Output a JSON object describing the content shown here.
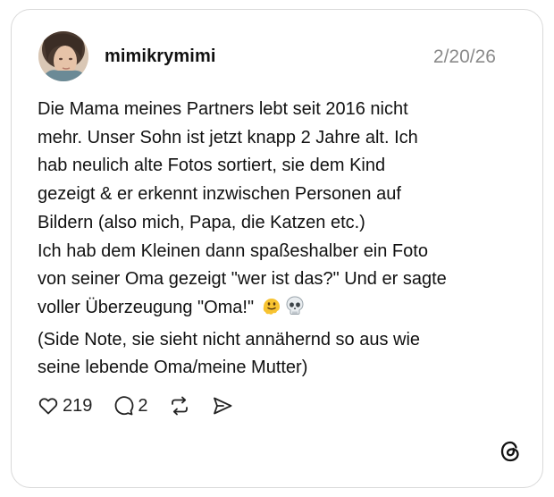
{
  "post": {
    "username": "mimikrymimi",
    "date": "2/20/26",
    "text_lines": [
      "Die Mama meines Partners lebt seit 2016 nicht",
      "mehr. Unser Sohn ist jetzt knapp 2 Jahre alt. Ich",
      "hab neulich alte Fotos sortiert, sie dem Kind",
      "gezeigt & er erkennt inzwischen Personen auf",
      "Bildern (also mich, Papa, die Katzen etc.)",
      "Ich hab dem Kleinen dann spaßeshalber ein Foto",
      "von seiner Oma gezeigt \"wer ist das?\" Und er sagte",
      "voller Überzeugung \"Oma!\"",
      "(Side Note, sie sieht nicht annähernd so aus wie",
      "seine lebende Oma/meine Mutter)"
    ],
    "emojis": [
      "melting-face-icon",
      "skull-icon"
    ]
  },
  "actions": {
    "like_count": "219",
    "reply_count": "2",
    "icons": [
      "heart-icon",
      "comment-icon",
      "repost-icon",
      "share-icon"
    ]
  },
  "branding": {
    "logo": "threads-logo-icon"
  },
  "colors": {
    "text": "#111111",
    "muted": "#8a8a8a",
    "border": "#d9d9d9",
    "emoji_yellow": "#f7c331"
  }
}
